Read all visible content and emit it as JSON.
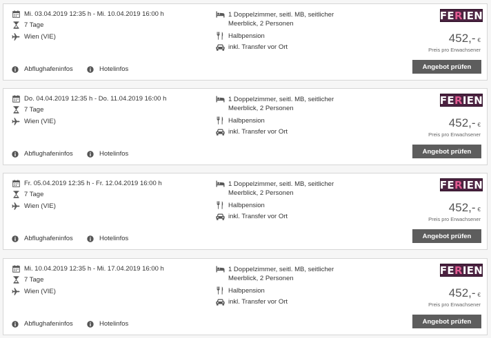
{
  "offers": [
    {
      "dates": "Mi. 03.04.2019 12:35 h - Mi. 10.04.2019 16:00 h",
      "duration": "7 Tage",
      "airport": "Wien (VIE)",
      "room_line1": "1 Doppelzimmer, seitl. MB, seitlicher",
      "room_line2": "Meerblick, 2 Personen",
      "board": "Halbpension",
      "transfer": "inkl. Transfer vor Ort",
      "airport_info": "Abflughafeninfos",
      "hotel_info": "Hotelinfos",
      "logo_left": "FE",
      "logo_accent": "R",
      "logo_right": "IEN",
      "price": "452,-",
      "currency": "€",
      "price_note": "Preis pro Erwachsener",
      "button": "Angebot prüfen"
    },
    {
      "dates": "Do. 04.04.2019 12:35 h - Do. 11.04.2019 16:00 h",
      "duration": "7 Tage",
      "airport": "Wien (VIE)",
      "room_line1": "1 Doppelzimmer, seitl. MB, seitlicher",
      "room_line2": "Meerblick, 2 Personen",
      "board": "Halbpension",
      "transfer": "inkl. Transfer vor Ort",
      "airport_info": "Abflughafeninfos",
      "hotel_info": "Hotelinfos",
      "logo_left": "FE",
      "logo_accent": "R",
      "logo_right": "IEN",
      "price": "452,-",
      "currency": "€",
      "price_note": "Preis pro Erwachsener",
      "button": "Angebot prüfen"
    },
    {
      "dates": "Fr. 05.04.2019 12:35 h - Fr. 12.04.2019 16:00 h",
      "duration": "7 Tage",
      "airport": "Wien (VIE)",
      "room_line1": "1 Doppelzimmer, seitl. MB, seitlicher",
      "room_line2": "Meerblick, 2 Personen",
      "board": "Halbpension",
      "transfer": "inkl. Transfer vor Ort",
      "airport_info": "Abflughafeninfos",
      "hotel_info": "Hotelinfos",
      "logo_left": "FE",
      "logo_accent": "R",
      "logo_right": "IEN",
      "price": "452,-",
      "currency": "€",
      "price_note": "Preis pro Erwachsener",
      "button": "Angebot prüfen"
    },
    {
      "dates": "Mi. 10.04.2019 12:35 h - Mi. 17.04.2019 16:00 h",
      "duration": "7 Tage",
      "airport": "Wien (VIE)",
      "room_line1": "1 Doppelzimmer, seitl. MB, seitlicher",
      "room_line2": "Meerblick, 2 Personen",
      "board": "Halbpension",
      "transfer": "inkl. Transfer vor Ort",
      "airport_info": "Abflughafeninfos",
      "hotel_info": "Hotelinfos",
      "logo_left": "FE",
      "logo_accent": "R",
      "logo_right": "IEN",
      "price": "452,-",
      "currency": "€",
      "price_note": "Preis pro Erwachsener",
      "button": "Angebot prüfen"
    }
  ],
  "icons": {
    "dates": "calendar-icon",
    "duration": "hourglass-icon",
    "airport": "plane-icon",
    "room": "bed-icon",
    "board": "cutlery-icon",
    "transfer": "car-icon",
    "info": "info-icon"
  },
  "colors": {
    "button_bg": "#5d5d5d",
    "logo_bg": "#4b2240",
    "logo_accent": "#e25b93",
    "price": "#555555"
  }
}
